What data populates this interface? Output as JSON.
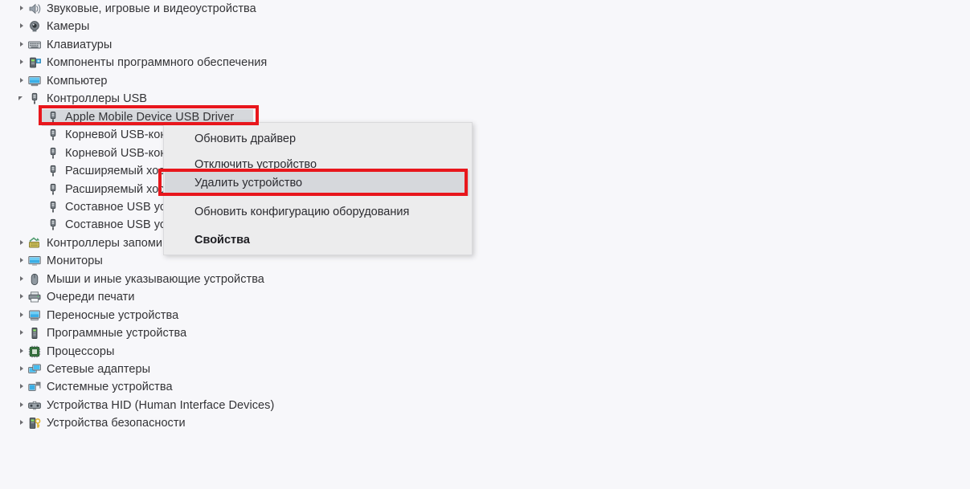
{
  "window": {
    "background_color": "#f7f7fa",
    "accent_color": "#e8161c",
    "selection_color": "#d6d8dc"
  },
  "tree": {
    "items": [
      {
        "label": "Звуковые, игровые и видеоустройства",
        "icon": "speaker-icon",
        "indent": 0,
        "expander": "collapsed",
        "selected": false,
        "clipped": false
      },
      {
        "label": "Камеры",
        "icon": "camera-icon",
        "indent": 0,
        "expander": "collapsed",
        "selected": false,
        "clipped": false
      },
      {
        "label": "Клавиатуры",
        "icon": "keyboard-icon",
        "indent": 0,
        "expander": "collapsed",
        "selected": false,
        "clipped": false
      },
      {
        "label": "Компоненты программного обеспечения",
        "icon": "software-component-icon",
        "indent": 0,
        "expander": "collapsed",
        "selected": false,
        "clipped": false
      },
      {
        "label": "Компьютер",
        "icon": "computer-icon",
        "indent": 0,
        "expander": "collapsed",
        "selected": false,
        "clipped": false
      },
      {
        "label": "Контроллеры USB",
        "icon": "usb-icon",
        "indent": 0,
        "expander": "expanded",
        "selected": false,
        "clipped": false
      },
      {
        "label": "Apple Mobile Device USB Driver",
        "icon": "usb-icon",
        "indent": 1,
        "expander": "none",
        "selected": true,
        "clipped": false
      },
      {
        "label": "Корневой USB-концентратор",
        "icon": "usb-icon",
        "indent": 1,
        "expander": "none",
        "selected": false,
        "clipped": true
      },
      {
        "label": "Корневой USB-концентратор",
        "icon": "usb-icon",
        "indent": 1,
        "expander": "none",
        "selected": false,
        "clipped": true
      },
      {
        "label": "Расширяемый хост-контроллер",
        "icon": "usb-icon",
        "indent": 1,
        "expander": "none",
        "selected": false,
        "clipped": true
      },
      {
        "label": "Расширяемый хост-контроллер",
        "icon": "usb-icon",
        "indent": 1,
        "expander": "none",
        "selected": false,
        "clipped": true
      },
      {
        "label": "Составное USB устройство",
        "icon": "usb-icon",
        "indent": 1,
        "expander": "none",
        "selected": false,
        "clipped": true
      },
      {
        "label": "Составное USB устройство",
        "icon": "usb-icon",
        "indent": 1,
        "expander": "none",
        "selected": false,
        "clipped": true
      },
      {
        "label": "Контроллеры запоминающих устройств",
        "icon": "storage-controller-icon",
        "indent": 0,
        "expander": "collapsed",
        "selected": false,
        "clipped": true
      },
      {
        "label": "Мониторы",
        "icon": "monitor-icon",
        "indent": 0,
        "expander": "collapsed",
        "selected": false,
        "clipped": false
      },
      {
        "label": "Мыши и иные указывающие устройства",
        "icon": "mouse-icon",
        "indent": 0,
        "expander": "collapsed",
        "selected": false,
        "clipped": false
      },
      {
        "label": "Очереди печати",
        "icon": "printer-icon",
        "indent": 0,
        "expander": "collapsed",
        "selected": false,
        "clipped": false
      },
      {
        "label": "Переносные устройства",
        "icon": "portable-device-icon",
        "indent": 0,
        "expander": "collapsed",
        "selected": false,
        "clipped": false
      },
      {
        "label": "Программные устройства",
        "icon": "software-device-icon",
        "indent": 0,
        "expander": "collapsed",
        "selected": false,
        "clipped": false
      },
      {
        "label": "Процессоры",
        "icon": "processor-icon",
        "indent": 0,
        "expander": "collapsed",
        "selected": false,
        "clipped": false
      },
      {
        "label": "Сетевые адаптеры",
        "icon": "network-adapter-icon",
        "indent": 0,
        "expander": "collapsed",
        "selected": false,
        "clipped": false
      },
      {
        "label": "Системные устройства",
        "icon": "system-device-icon",
        "indent": 0,
        "expander": "collapsed",
        "selected": false,
        "clipped": false
      },
      {
        "label": "Устройства HID (Human Interface Devices)",
        "icon": "hid-device-icon",
        "indent": 0,
        "expander": "collapsed",
        "selected": false,
        "clipped": false
      },
      {
        "label": "Устройства безопасности",
        "icon": "security-device-icon",
        "indent": 0,
        "expander": "collapsed",
        "selected": false,
        "clipped": false
      }
    ]
  },
  "context_menu": {
    "items": [
      {
        "label": "Обновить драйвер",
        "highlighted": false,
        "bold": false
      },
      {
        "label": "Отключить устройство",
        "highlighted": false,
        "bold": false
      },
      {
        "label": "Удалить устройство",
        "highlighted": true,
        "bold": false
      },
      {
        "label": "Обновить конфигурацию оборудования",
        "highlighted": false,
        "bold": false
      },
      {
        "label": "Свойства",
        "highlighted": false,
        "bold": true
      }
    ]
  },
  "annotations": [
    {
      "name": "selected-device-highlight-box",
      "target": "Apple Mobile Device USB Driver"
    },
    {
      "name": "uninstall-device-highlight-box",
      "target": "Удалить устройство"
    }
  ]
}
